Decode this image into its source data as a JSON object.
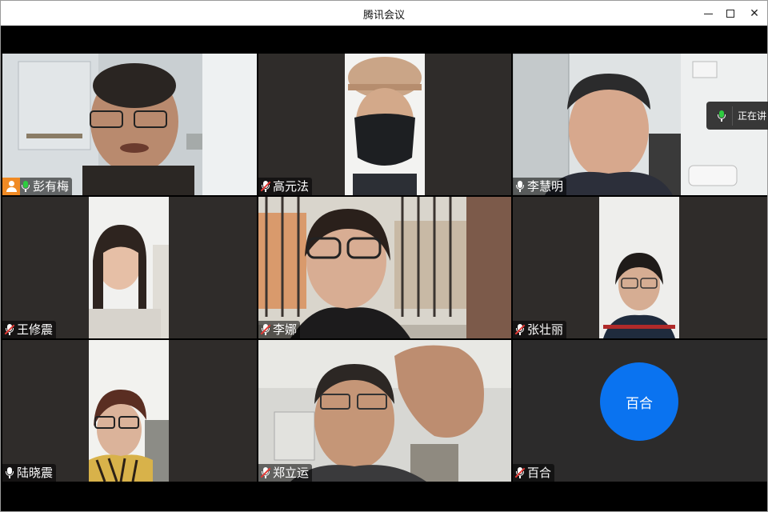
{
  "window": {
    "title": "腾讯会议"
  },
  "speaking_indicator": {
    "label": "正在讲"
  },
  "participants": [
    {
      "name": "彭有梅",
      "host": true,
      "mic": "active"
    },
    {
      "name": "高元法",
      "host": false,
      "mic": "muted"
    },
    {
      "name": "李慧明",
      "host": false,
      "mic": "on"
    },
    {
      "name": "王修震",
      "host": false,
      "mic": "muted"
    },
    {
      "name": "李娜",
      "host": false,
      "mic": "muted"
    },
    {
      "name": "张壮丽",
      "host": false,
      "mic": "muted"
    },
    {
      "name": "陆晓震",
      "host": false,
      "mic": "on"
    },
    {
      "name": "郑立运",
      "host": false,
      "mic": "muted"
    },
    {
      "name": "百合",
      "host": false,
      "mic": "muted",
      "avatar_text": "百合"
    }
  ],
  "colors": {
    "active_border": "#2ed17f",
    "host_badge": "#f08a24",
    "avatar_bg": "#0a73f0",
    "tile_bg": "#2f2c2a"
  }
}
